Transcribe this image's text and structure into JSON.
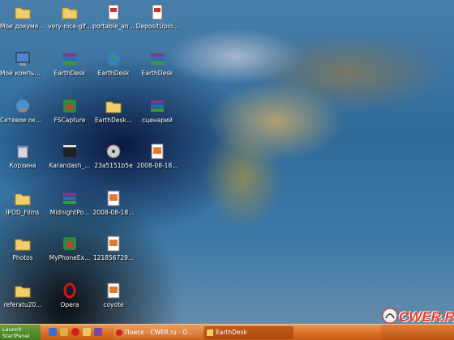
{
  "desktop": {
    "icons": [
      {
        "label": "Мои документы",
        "type": "folder"
      },
      {
        "label": "very-nice-gif...",
        "type": "folder"
      },
      {
        "label": "portable_an...",
        "type": "file"
      },
      {
        "label": "DepositUplo...",
        "type": "file"
      },
      {
        "label": "Мой компьютер",
        "type": "computer"
      },
      {
        "label": "EarthDesk",
        "type": "archive"
      },
      {
        "label": "EarthDesk",
        "type": "globe"
      },
      {
        "label": "EarthDesk",
        "type": "archive"
      },
      {
        "label": "Сетевое окружение",
        "type": "network"
      },
      {
        "label": "FSCapture",
        "type": "app"
      },
      {
        "label": "EarthDesk...",
        "type": "folder"
      },
      {
        "label": "сценарий",
        "type": "archive"
      },
      {
        "label": "Корзина",
        "type": "trash"
      },
      {
        "label": "Karandash_...",
        "type": "video"
      },
      {
        "label": "23a5151b5e",
        "type": "disc"
      },
      {
        "label": "2008-08-18...",
        "type": "image"
      },
      {
        "label": "IPOD_Films",
        "type": "folder"
      },
      {
        "label": "MidnightPo...",
        "type": "archive"
      },
      {
        "label": "2008-08-18...",
        "type": "image"
      },
      {
        "label": "Photos",
        "type": "folder"
      },
      {
        "label": "MyPhoneEx...",
        "type": "app"
      },
      {
        "label": "121856729...",
        "type": "image"
      },
      {
        "label": "referatu20...",
        "type": "folder"
      },
      {
        "label": "Opera",
        "type": "opera"
      },
      {
        "label": "coyote",
        "type": "image"
      }
    ]
  },
  "taskbar": {
    "start_label": "Launch StartPanel",
    "tasks": [
      {
        "label": "Поиск - CWER.ru - O..."
      },
      {
        "label": "EarthDesk"
      }
    ]
  },
  "watermark": {
    "text": "CWER.RU"
  },
  "colors": {
    "taskbar": "#d86b22",
    "start": "#4f8a2a",
    "accent": "#e63a2a"
  }
}
